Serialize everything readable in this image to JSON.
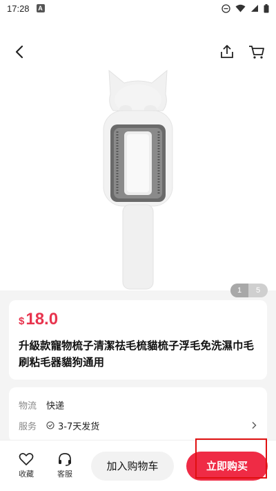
{
  "status_bar": {
    "time": "17:28",
    "notification_letter": "A",
    "icons": [
      "dnd-icon",
      "wifi-icon",
      "signal-icon",
      "battery-icon"
    ]
  },
  "gallery": {
    "pager_current": "1",
    "pager_total": "5"
  },
  "product": {
    "currency_symbol": "$",
    "price": "18.0",
    "title": "升級款寵物梳子清潔祛毛梳貓梳子浮毛免洗濕巾毛刷粘毛器貓狗通用"
  },
  "info": {
    "logistics_label": "物流",
    "logistics_value": "快递",
    "service_label": "服务",
    "service_value": "3-7天发货"
  },
  "bottom_bar": {
    "favorite_label": "收藏",
    "service_label": "客服",
    "add_to_cart_label": "加入购物车",
    "buy_now_label": "立即购买"
  },
  "colors": {
    "accent": "#ef2b45",
    "price": "#e8344e",
    "highlight": "#e01010"
  }
}
